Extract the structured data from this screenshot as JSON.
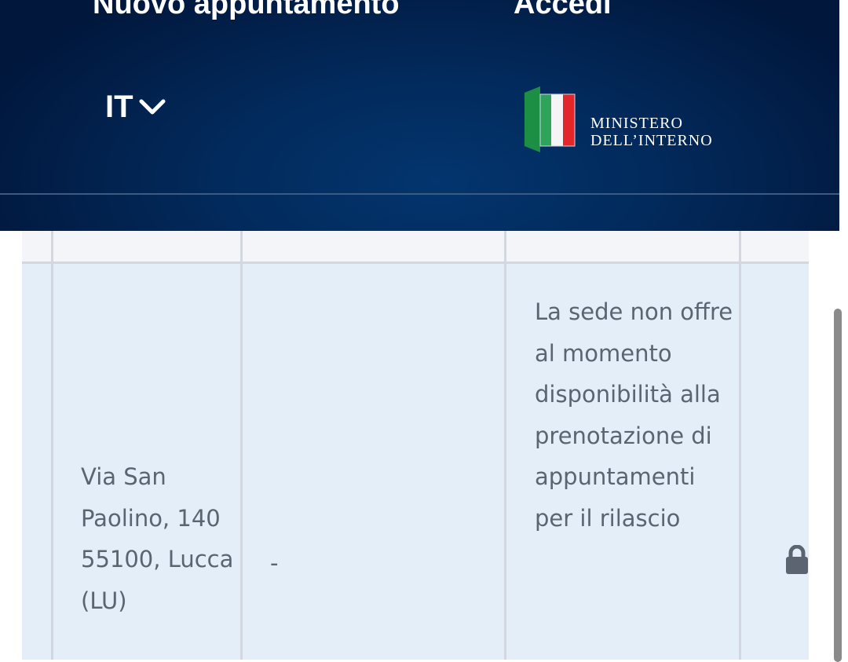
{
  "header": {
    "nav": {
      "new_appointment": "Nuovo appuntamento",
      "login": "Accedi"
    },
    "language": {
      "selected": "IT",
      "icon": "chevron-down-icon"
    },
    "logo": {
      "line1": "MINISTERO",
      "line2": "DELL’INTERNO"
    }
  },
  "table": {
    "row": {
      "address": "Via San Paolino, 140 55100, Lucca (LU)",
      "dash": "-",
      "availability": "La sede non offre al momento disponibilità alla prenotazione di appuntamenti per il rilascio",
      "status_icon": "lock-icon"
    }
  },
  "colors": {
    "header_bg": "#022a5c",
    "row_bg": "#e3eef8",
    "header_row_bg": "#f4f5f8",
    "cell_text": "#5b6470"
  }
}
